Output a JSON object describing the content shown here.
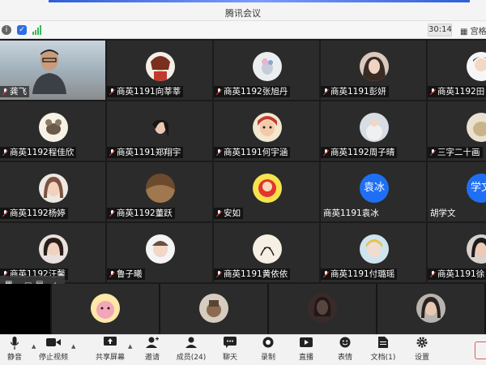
{
  "window": {
    "title": "腾讯会议"
  },
  "info_bar": {
    "timer": "30:14",
    "gallery_label": "宫格"
  },
  "grid": {
    "rows": [
      [
        "龚飞",
        "商英1191向莘莘",
        "商英1192张旭丹",
        "商英1191彭妍",
        "商英1192田"
      ],
      [
        "商英1192程佳欣",
        "商英1191郑翔宇",
        "商英1191何宇涵",
        "商英1192周子晴",
        "三字二十画"
      ],
      [
        "商英1192杨婷",
        "商英1192董跃",
        "安如",
        "商英1191袁冰",
        "胡学文"
      ],
      [
        "商英1192汪馨",
        "鲁子曦",
        "商英1191黄依依",
        "商英1191付璐瑶",
        "商英1191徐"
      ]
    ],
    "text_avatars": {
      "r2c3": "袁冰",
      "r2c4": "学文"
    }
  },
  "toolbar": {
    "mute": "静音",
    "stop_video": "停止视频",
    "share": "共享屏幕",
    "invite": "邀请",
    "members": "成员(24)",
    "chat": "聊天",
    "record": "录制",
    "live": "直播",
    "emoji": "表情",
    "docs": "文档(1)",
    "settings": "设置"
  },
  "icons": {
    "info": "info-icon",
    "shield": "shield-icon",
    "signal": "signal-icon",
    "grid": "grid-icon",
    "mic": "mic-icon",
    "video": "video-icon",
    "share": "share-screen-icon",
    "invite": "invite-icon",
    "members": "members-icon",
    "chat": "chat-icon",
    "record": "record-icon",
    "live": "live-icon",
    "emoji": "emoji-icon",
    "docs": "document-icon",
    "settings": "gear-icon"
  },
  "colors": {
    "accent": "#1f6ff5",
    "tile_bg": "#2b2b2b",
    "grid_bg": "#1b1b1b"
  }
}
